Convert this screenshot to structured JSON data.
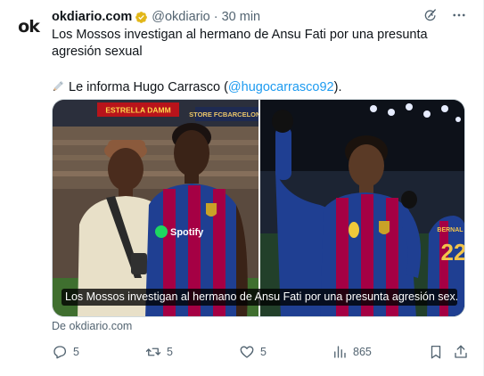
{
  "account": {
    "logo_text": "ok",
    "name": "okdiario.com",
    "handle": "@okdiario",
    "separator": "·",
    "time": "30 min"
  },
  "tweet": {
    "text_line1": "Los Mossos investigan al hermano de Ansu Fati por una presunta agresión sexual",
    "text_line2_prefix": "Le informa Hugo Carrasco (",
    "mention": "@hugocarrasco92",
    "text_line2_suffix": ")."
  },
  "media": {
    "caption": "Los Mossos investigan al hermano de Ansu Fati por una presunta agresión sex...",
    "left_photo": {
      "banner_text": "ESTRELLA DAMM",
      "store_text": "STORE FCBARCELONA",
      "sponsor_text": "Spotify"
    },
    "right_photo": {
      "jersey_text": "BERNAL",
      "jersey_number": "22"
    }
  },
  "source": "De okdiario.com",
  "actions": {
    "replies": "5",
    "reposts": "5",
    "likes": "5",
    "views": "865"
  },
  "colors": {
    "accent": "#1d9bf0",
    "verified": "#e2b719",
    "muted": "#536471",
    "barca_blue": "#1f3f92",
    "barca_red": "#a50044"
  }
}
